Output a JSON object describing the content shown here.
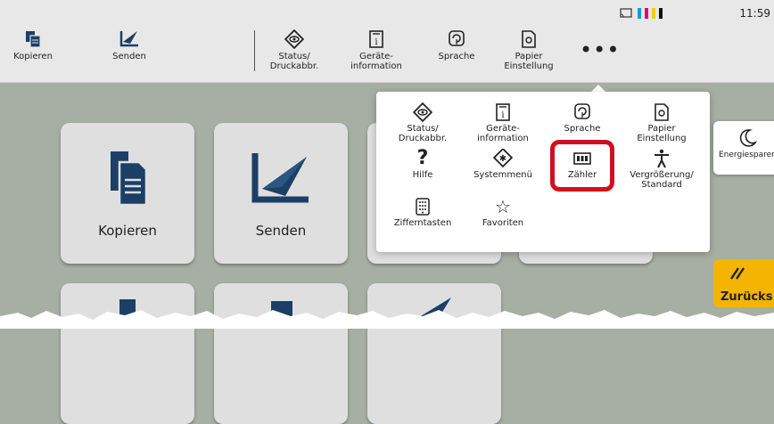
{
  "status": {
    "time": "11:59",
    "ink_colors": [
      "#00a0e0",
      "#e0007a",
      "#f0d000",
      "#111111"
    ]
  },
  "toolbar": {
    "items": [
      {
        "label": "Kopieren",
        "icon": "copy-icon"
      },
      {
        "label": "Senden",
        "icon": "send-icon"
      },
      {
        "label": "Status/\nDruckabbr.",
        "icon": "eye-icon"
      },
      {
        "label": "Geräte-\ninformation",
        "icon": "device-info-icon"
      },
      {
        "label": "Sprache",
        "icon": "language-icon"
      },
      {
        "label": "Papier\nEinstellung",
        "icon": "paper-settings-icon"
      }
    ],
    "more": "•••"
  },
  "tiles": [
    {
      "label": "Kopieren",
      "icon": "copy-icon"
    },
    {
      "label": "Senden",
      "icon": "send-icon"
    }
  ],
  "popup": {
    "items": [
      {
        "label": "Status/\nDruckabbr.",
        "icon": "eye-icon"
      },
      {
        "label": "Geräte-\ninformation",
        "icon": "device-info-icon"
      },
      {
        "label": "Sprache",
        "icon": "language-icon"
      },
      {
        "label": "Papier\nEinstellung",
        "icon": "paper-settings-icon"
      },
      {
        "label": "Hilfe",
        "icon": "help-icon"
      },
      {
        "label": "Systemmenü",
        "icon": "system-menu-icon"
      },
      {
        "label": "Zähler",
        "icon": "counter-icon"
      },
      {
        "label": "Vergrößerung/\nStandard",
        "icon": "accessibility-icon"
      },
      {
        "label": "Zifferntasten",
        "icon": "keypad-icon"
      },
      {
        "label": "Favoriten",
        "icon": "star-icon"
      }
    ]
  },
  "side": {
    "energy_label": "Energiesparen",
    "back_label": "Zurücks"
  }
}
